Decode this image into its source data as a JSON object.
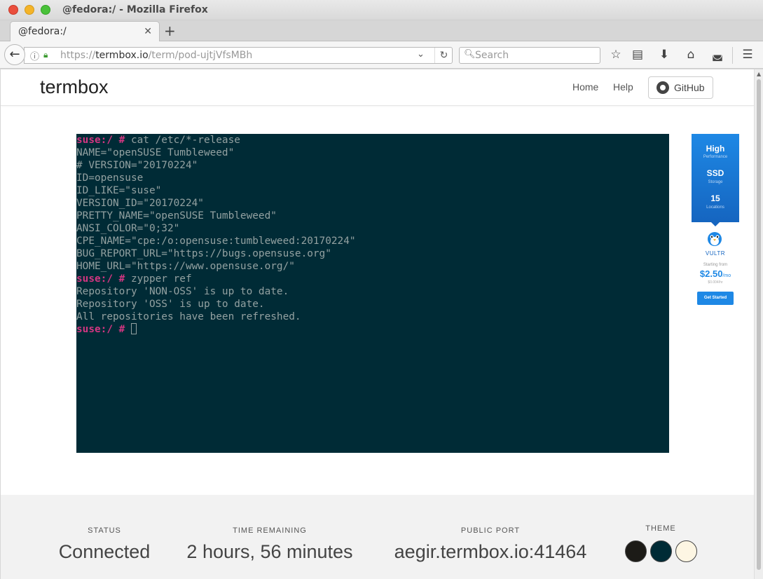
{
  "window": {
    "title": "@fedora:/ - Mozilla Firefox"
  },
  "tabs": [
    {
      "label": "@fedora:/"
    }
  ],
  "toolbar": {
    "url_scheme": "https://",
    "url_host": "termbox.io",
    "url_path": "/term/pod-ujtjVfsMBh",
    "search_placeholder": "Search",
    "icons": [
      "back-icon",
      "info-icon",
      "lock-icon",
      "dropdown-icon",
      "reload-icon",
      "search-icon",
      "bookmark-star-icon",
      "reading-list-icon",
      "download-icon",
      "home-icon",
      "pocket-icon",
      "menu-icon"
    ]
  },
  "site": {
    "brand": "termbox",
    "nav": [
      "Home",
      "Help"
    ],
    "github_label": "GitHub"
  },
  "terminal": {
    "prompt": "suse:/ #",
    "lines": [
      {
        "prompt": "suse:/ #",
        "text": " cat /etc/*-release"
      },
      {
        "text": "NAME=\"openSUSE Tumbleweed\""
      },
      {
        "text": "# VERSION=\"20170224\""
      },
      {
        "text": "ID=opensuse"
      },
      {
        "text": "ID_LIKE=\"suse\""
      },
      {
        "text": "VERSION_ID=\"20170224\""
      },
      {
        "text": "PRETTY_NAME=\"openSUSE Tumbleweed\""
      },
      {
        "text": "ANSI_COLOR=\"0;32\""
      },
      {
        "text": "CPE_NAME=\"cpe:/o:opensuse:tumbleweed:20170224\""
      },
      {
        "text": "BUG_REPORT_URL=\"https://bugs.opensuse.org\""
      },
      {
        "text": "HOME_URL=\"https://www.opensuse.org/\""
      },
      {
        "prompt": "suse:/ #",
        "text": " zypper ref"
      },
      {
        "text": "Repository 'NON-OSS' is up to date."
      },
      {
        "text": "Repository 'OSS' is up to date."
      },
      {
        "text": "All repositories have been refreshed."
      },
      {
        "prompt": "suse:/ #",
        "text": " ",
        "cursor": true
      }
    ]
  },
  "ad": {
    "line1": "High",
    "line1_sub": "Performance",
    "line2": "SSD",
    "line2_sub": "Storage",
    "line3": "15",
    "line3_sub": "Locations",
    "logo": "VULTR",
    "starting": "Starting from",
    "price": "$2.50",
    "price_unit": "/mo",
    "hourly": "$0.004/hr",
    "cta": "Get Started"
  },
  "footer": {
    "status_label": "STATUS",
    "status_value": "Connected",
    "time_label": "TIME REMAINING",
    "time_value": "2 hours, 56 minutes",
    "port_label": "PUBLIC PORT",
    "port_value": "aegir.termbox.io:41464",
    "theme_label": "THEME",
    "themes": [
      "#1c1b17",
      "#002b36",
      "#fdf6e3"
    ]
  }
}
